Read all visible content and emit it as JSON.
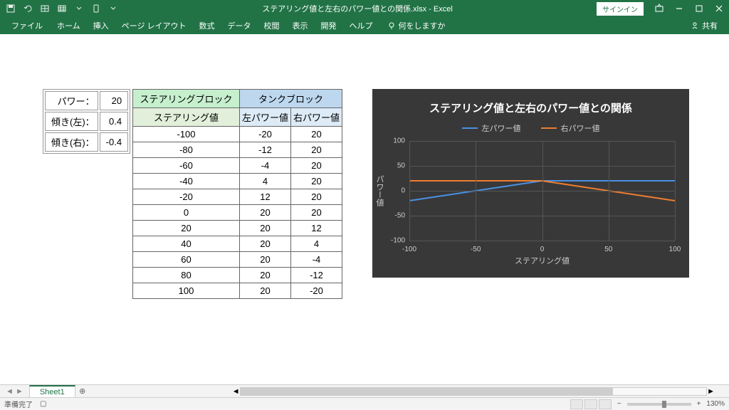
{
  "title": "ステアリング値と左右のパワー値との関係.xlsx - Excel",
  "signin": "サインイン",
  "ribbon": {
    "file": "ファイル",
    "tabs": [
      "ホーム",
      "挿入",
      "ページ レイアウト",
      "数式",
      "データ",
      "校閲",
      "表示",
      "開発",
      "ヘルプ"
    ],
    "tellme": "何をしますか",
    "share": "共有"
  },
  "params": {
    "power_lbl": "パワー：",
    "power_val": "20",
    "tilt_l_lbl": "傾き(左)：",
    "tilt_l_val": "0.4",
    "tilt_r_lbl": "傾き(右)：",
    "tilt_r_val": "-0.4"
  },
  "table": {
    "hdr_steer": "ステアリングブロック",
    "hdr_tank": "タンクブロック",
    "sub_steer": "ステアリング値",
    "sub_left": "左パワー値",
    "sub_right": "右パワー値",
    "rows": [
      {
        "s": "-100",
        "l": "-20",
        "r": "20"
      },
      {
        "s": "-80",
        "l": "-12",
        "r": "20"
      },
      {
        "s": "-60",
        "l": "-4",
        "r": "20"
      },
      {
        "s": "-40",
        "l": "4",
        "r": "20"
      },
      {
        "s": "-20",
        "l": "12",
        "r": "20"
      },
      {
        "s": "0",
        "l": "20",
        "r": "20"
      },
      {
        "s": "20",
        "l": "20",
        "r": "12"
      },
      {
        "s": "40",
        "l": "20",
        "r": "4"
      },
      {
        "s": "60",
        "l": "20",
        "r": "-4"
      },
      {
        "s": "80",
        "l": "20",
        "r": "-12"
      },
      {
        "s": "100",
        "l": "20",
        "r": "-20"
      }
    ]
  },
  "chart_data": {
    "type": "line",
    "title": "ステアリング値と左右のパワー値との関係",
    "xlabel": "ステアリング値",
    "ylabel": "パワー値",
    "x": [
      -100,
      -80,
      -60,
      -40,
      -20,
      0,
      20,
      40,
      60,
      80,
      100
    ],
    "series": [
      {
        "name": "左パワー値",
        "color": "#4a90e2",
        "values": [
          -20,
          -12,
          -4,
          4,
          12,
          20,
          20,
          20,
          20,
          20,
          20
        ]
      },
      {
        "name": "右パワー値",
        "color": "#ed7d31",
        "values": [
          20,
          20,
          20,
          20,
          20,
          20,
          12,
          4,
          -4,
          -12,
          -20
        ]
      }
    ],
    "ylim": [
      -100,
      100
    ],
    "yticks": [
      -100,
      -50,
      0,
      50,
      100
    ],
    "xticks": [
      -100,
      -50,
      0,
      50,
      100
    ]
  },
  "sheet": "Sheet1",
  "status": "準備完了",
  "zoom": "130%"
}
